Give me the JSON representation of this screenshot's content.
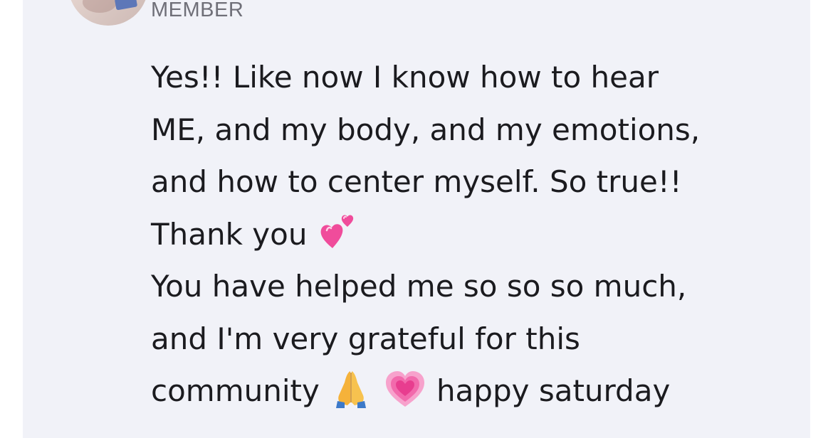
{
  "member_badge": "MEMBER",
  "message": {
    "lines": [
      "Yes!! Like now I know how to hear",
      "ME, and my body, and my emotions,",
      "and how to center myself. So true!!",
      "Thank you",
      "You have helped me so so so much,",
      "and I'm very grateful for this",
      "community",
      "happy saturday"
    ]
  },
  "icons": {
    "two_hearts": "two-hearts-icon",
    "folded_hands": "folded-hands-icon",
    "growing_heart": "growing-heart-icon"
  },
  "colors": {
    "card_background": "#f1f2f8",
    "text": "#1b1b1f",
    "badge_text": "#6f6f78",
    "heart_pink": "#f04c9b"
  }
}
